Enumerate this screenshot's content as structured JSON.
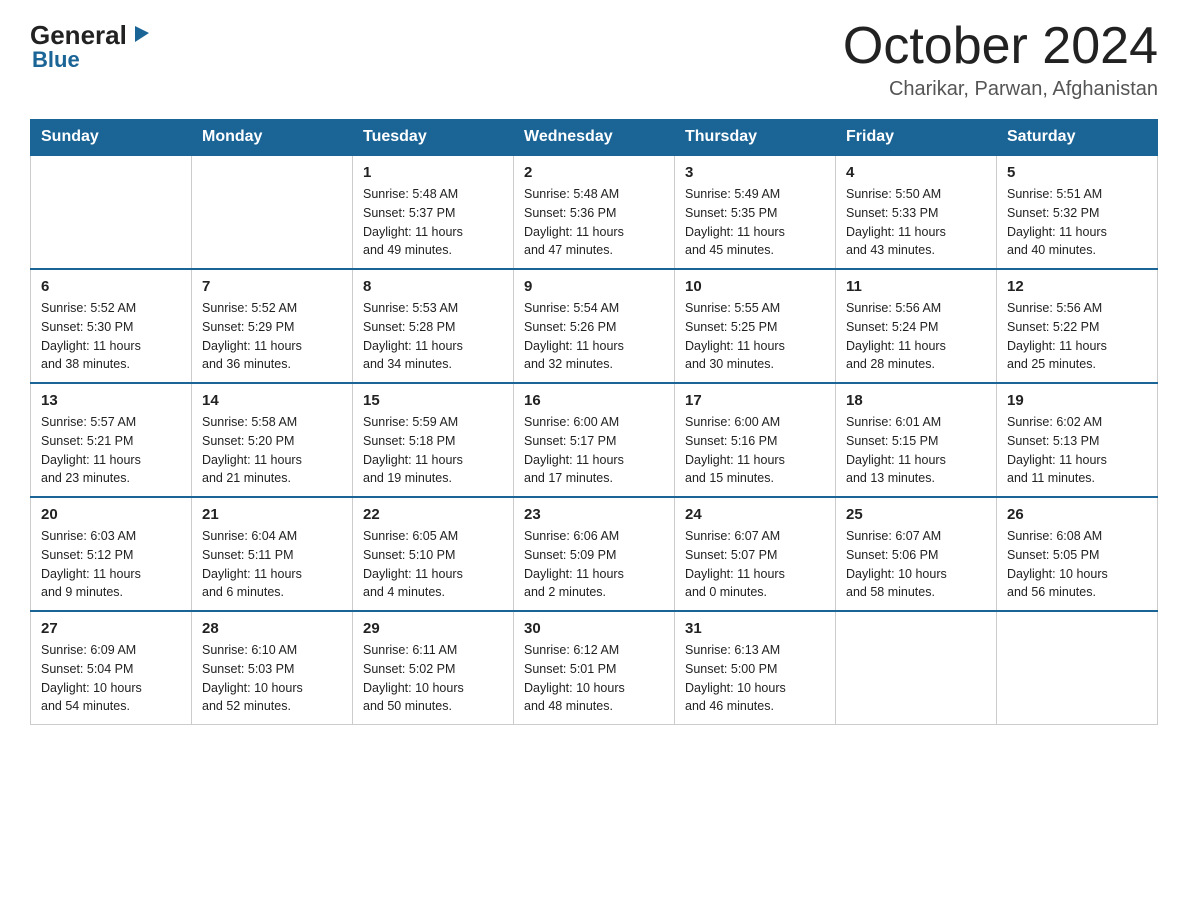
{
  "header": {
    "logo": {
      "general": "General",
      "blue": "Blue"
    },
    "title": "October 2024",
    "subtitle": "Charikar, Parwan, Afghanistan"
  },
  "days_of_week": [
    "Sunday",
    "Monday",
    "Tuesday",
    "Wednesday",
    "Thursday",
    "Friday",
    "Saturday"
  ],
  "weeks": [
    [
      {
        "num": "",
        "info": ""
      },
      {
        "num": "",
        "info": ""
      },
      {
        "num": "1",
        "info": "Sunrise: 5:48 AM\nSunset: 5:37 PM\nDaylight: 11 hours\nand 49 minutes."
      },
      {
        "num": "2",
        "info": "Sunrise: 5:48 AM\nSunset: 5:36 PM\nDaylight: 11 hours\nand 47 minutes."
      },
      {
        "num": "3",
        "info": "Sunrise: 5:49 AM\nSunset: 5:35 PM\nDaylight: 11 hours\nand 45 minutes."
      },
      {
        "num": "4",
        "info": "Sunrise: 5:50 AM\nSunset: 5:33 PM\nDaylight: 11 hours\nand 43 minutes."
      },
      {
        "num": "5",
        "info": "Sunrise: 5:51 AM\nSunset: 5:32 PM\nDaylight: 11 hours\nand 40 minutes."
      }
    ],
    [
      {
        "num": "6",
        "info": "Sunrise: 5:52 AM\nSunset: 5:30 PM\nDaylight: 11 hours\nand 38 minutes."
      },
      {
        "num": "7",
        "info": "Sunrise: 5:52 AM\nSunset: 5:29 PM\nDaylight: 11 hours\nand 36 minutes."
      },
      {
        "num": "8",
        "info": "Sunrise: 5:53 AM\nSunset: 5:28 PM\nDaylight: 11 hours\nand 34 minutes."
      },
      {
        "num": "9",
        "info": "Sunrise: 5:54 AM\nSunset: 5:26 PM\nDaylight: 11 hours\nand 32 minutes."
      },
      {
        "num": "10",
        "info": "Sunrise: 5:55 AM\nSunset: 5:25 PM\nDaylight: 11 hours\nand 30 minutes."
      },
      {
        "num": "11",
        "info": "Sunrise: 5:56 AM\nSunset: 5:24 PM\nDaylight: 11 hours\nand 28 minutes."
      },
      {
        "num": "12",
        "info": "Sunrise: 5:56 AM\nSunset: 5:22 PM\nDaylight: 11 hours\nand 25 minutes."
      }
    ],
    [
      {
        "num": "13",
        "info": "Sunrise: 5:57 AM\nSunset: 5:21 PM\nDaylight: 11 hours\nand 23 minutes."
      },
      {
        "num": "14",
        "info": "Sunrise: 5:58 AM\nSunset: 5:20 PM\nDaylight: 11 hours\nand 21 minutes."
      },
      {
        "num": "15",
        "info": "Sunrise: 5:59 AM\nSunset: 5:18 PM\nDaylight: 11 hours\nand 19 minutes."
      },
      {
        "num": "16",
        "info": "Sunrise: 6:00 AM\nSunset: 5:17 PM\nDaylight: 11 hours\nand 17 minutes."
      },
      {
        "num": "17",
        "info": "Sunrise: 6:00 AM\nSunset: 5:16 PM\nDaylight: 11 hours\nand 15 minutes."
      },
      {
        "num": "18",
        "info": "Sunrise: 6:01 AM\nSunset: 5:15 PM\nDaylight: 11 hours\nand 13 minutes."
      },
      {
        "num": "19",
        "info": "Sunrise: 6:02 AM\nSunset: 5:13 PM\nDaylight: 11 hours\nand 11 minutes."
      }
    ],
    [
      {
        "num": "20",
        "info": "Sunrise: 6:03 AM\nSunset: 5:12 PM\nDaylight: 11 hours\nand 9 minutes."
      },
      {
        "num": "21",
        "info": "Sunrise: 6:04 AM\nSunset: 5:11 PM\nDaylight: 11 hours\nand 6 minutes."
      },
      {
        "num": "22",
        "info": "Sunrise: 6:05 AM\nSunset: 5:10 PM\nDaylight: 11 hours\nand 4 minutes."
      },
      {
        "num": "23",
        "info": "Sunrise: 6:06 AM\nSunset: 5:09 PM\nDaylight: 11 hours\nand 2 minutes."
      },
      {
        "num": "24",
        "info": "Sunrise: 6:07 AM\nSunset: 5:07 PM\nDaylight: 11 hours\nand 0 minutes."
      },
      {
        "num": "25",
        "info": "Sunrise: 6:07 AM\nSunset: 5:06 PM\nDaylight: 10 hours\nand 58 minutes."
      },
      {
        "num": "26",
        "info": "Sunrise: 6:08 AM\nSunset: 5:05 PM\nDaylight: 10 hours\nand 56 minutes."
      }
    ],
    [
      {
        "num": "27",
        "info": "Sunrise: 6:09 AM\nSunset: 5:04 PM\nDaylight: 10 hours\nand 54 minutes."
      },
      {
        "num": "28",
        "info": "Sunrise: 6:10 AM\nSunset: 5:03 PM\nDaylight: 10 hours\nand 52 minutes."
      },
      {
        "num": "29",
        "info": "Sunrise: 6:11 AM\nSunset: 5:02 PM\nDaylight: 10 hours\nand 50 minutes."
      },
      {
        "num": "30",
        "info": "Sunrise: 6:12 AM\nSunset: 5:01 PM\nDaylight: 10 hours\nand 48 minutes."
      },
      {
        "num": "31",
        "info": "Sunrise: 6:13 AM\nSunset: 5:00 PM\nDaylight: 10 hours\nand 46 minutes."
      },
      {
        "num": "",
        "info": ""
      },
      {
        "num": "",
        "info": ""
      }
    ]
  ]
}
